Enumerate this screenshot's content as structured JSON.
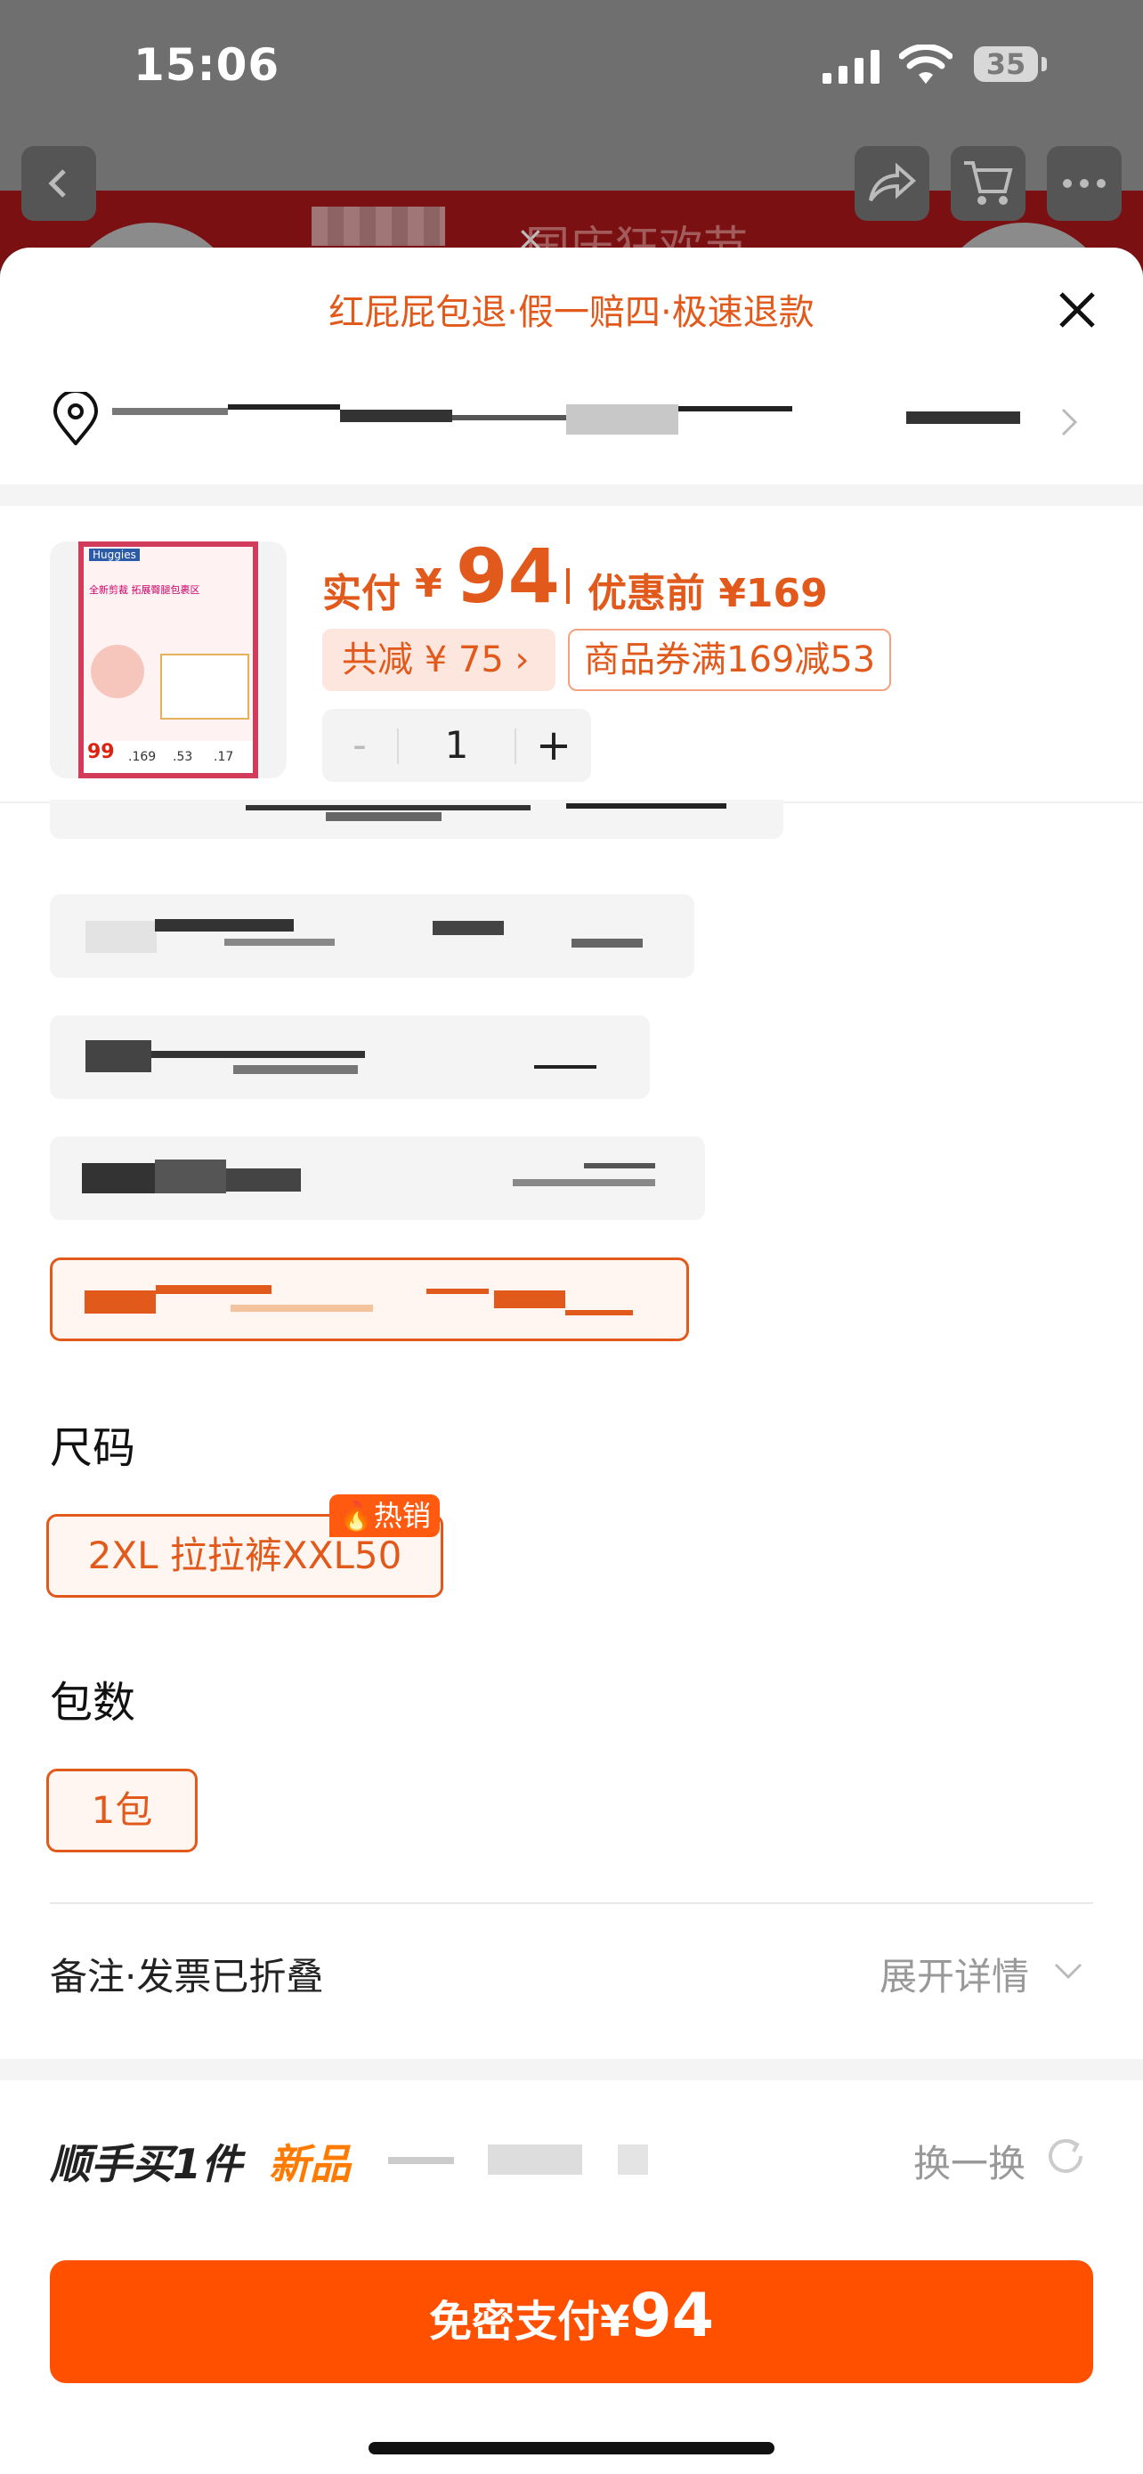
{
  "status_bar": {
    "time": "15:06",
    "battery": "35"
  },
  "background": {
    "page_title": "国庆狂欢节",
    "title_sep": "×"
  },
  "sheet": {
    "guarantee": "红屁屁包退·假一赔四·极速退款",
    "product": {
      "image_brand": "Huggies",
      "image_line1": "全新剪裁 拓展臀腿包裹区",
      "image_price": "99",
      "image_sizes": [
        ".169",
        ".53",
        ".17"
      ],
      "paid_label": "实付",
      "currency": "¥",
      "paid_amount": "94",
      "before_label": "优惠前 ¥169",
      "discount_label": "共减 ¥ 75 ›",
      "coupon_label": "商品券满169减53",
      "quantity": "1",
      "minus": "-",
      "plus": "+"
    },
    "size_section": {
      "title": "尺码",
      "option": "2XL 拉拉裤XXL50",
      "hot_badge": "热销"
    },
    "pack_section": {
      "title": "包数",
      "option": "1包"
    },
    "memo": {
      "label": "备注·发票已折叠",
      "expand": "展开详情"
    },
    "addon": {
      "title": "顺手买1件",
      "highlight": "新品",
      "swap": "换一换"
    },
    "pay": {
      "label": "免密支付",
      "currency": "¥",
      "amount": "94"
    }
  },
  "colors": {
    "accent": "#e2591c",
    "pay_button": "#ff5000"
  }
}
